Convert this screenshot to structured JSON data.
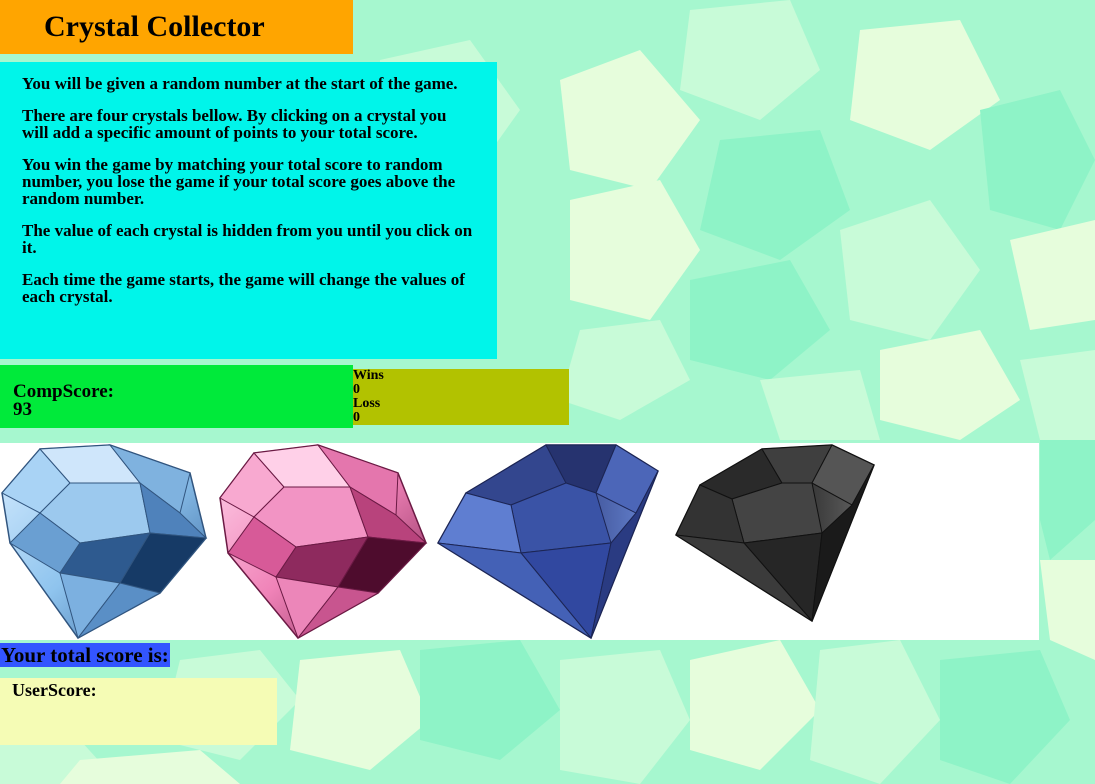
{
  "game": {
    "title": "Crystal Collector",
    "instructions": [
      "You will be given a random number at the start of the game.",
      "There are four crystals bellow. By clicking on a crystal you will add a specific amount of points to your total score.",
      "You win the game by matching your total score to random number, you lose the game if your total score goes above the random number.",
      "The value of each crystal is hidden from you until you click on it.",
      "Each time the game starts, the game will change the values of each crystal."
    ]
  },
  "comp_score": {
    "label": "CompScore:",
    "value": "93"
  },
  "stats": {
    "wins_label": "Wins",
    "wins_value": "0",
    "loss_label": "Loss",
    "loss_value": "0"
  },
  "crystals": [
    {
      "name": "blue-diamond-crystal",
      "color": "#8fc4ee"
    },
    {
      "name": "pink-diamond-crystal",
      "color": "#f083b8"
    },
    {
      "name": "dark-blue-crystal",
      "color": "#3a4f9a"
    },
    {
      "name": "black-crystal",
      "color": "#3a3a3a"
    }
  ],
  "total_label": "Your total score is:",
  "user_score": {
    "label": "UserScore:",
    "value": ""
  },
  "colors": {
    "background": "#a6f7cf",
    "title_bg": "#ffa500",
    "instructions_bg": "#00f5ea",
    "comp_bg": "#00ea3a",
    "stats_bg": "#b2c200",
    "total_label_bg": "#3355ff",
    "user_bg": "#f5fcb5"
  }
}
